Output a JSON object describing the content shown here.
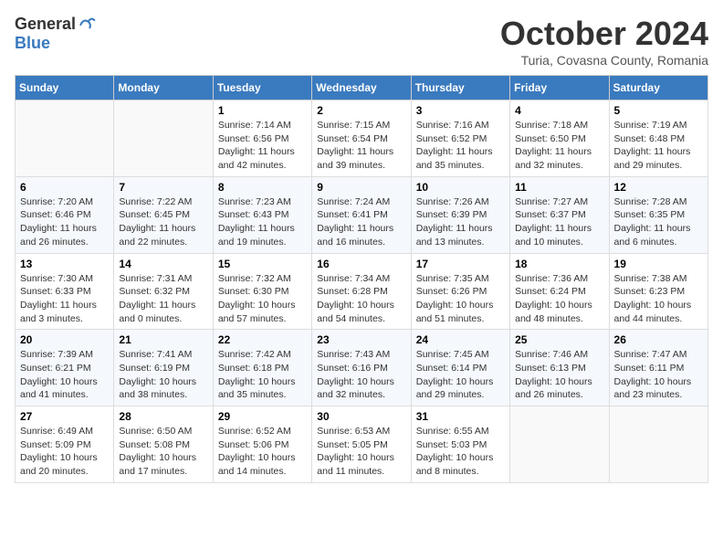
{
  "header": {
    "logo_general": "General",
    "logo_blue": "Blue",
    "month_title": "October 2024",
    "location": "Turia, Covasna County, Romania"
  },
  "weekdays": [
    "Sunday",
    "Monday",
    "Tuesday",
    "Wednesday",
    "Thursday",
    "Friday",
    "Saturday"
  ],
  "weeks": [
    [
      {
        "day": "",
        "sunrise": "",
        "sunset": "",
        "daylight": ""
      },
      {
        "day": "",
        "sunrise": "",
        "sunset": "",
        "daylight": ""
      },
      {
        "day": "1",
        "sunrise": "Sunrise: 7:14 AM",
        "sunset": "Sunset: 6:56 PM",
        "daylight": "Daylight: 11 hours and 42 minutes."
      },
      {
        "day": "2",
        "sunrise": "Sunrise: 7:15 AM",
        "sunset": "Sunset: 6:54 PM",
        "daylight": "Daylight: 11 hours and 39 minutes."
      },
      {
        "day": "3",
        "sunrise": "Sunrise: 7:16 AM",
        "sunset": "Sunset: 6:52 PM",
        "daylight": "Daylight: 11 hours and 35 minutes."
      },
      {
        "day": "4",
        "sunrise": "Sunrise: 7:18 AM",
        "sunset": "Sunset: 6:50 PM",
        "daylight": "Daylight: 11 hours and 32 minutes."
      },
      {
        "day": "5",
        "sunrise": "Sunrise: 7:19 AM",
        "sunset": "Sunset: 6:48 PM",
        "daylight": "Daylight: 11 hours and 29 minutes."
      }
    ],
    [
      {
        "day": "6",
        "sunrise": "Sunrise: 7:20 AM",
        "sunset": "Sunset: 6:46 PM",
        "daylight": "Daylight: 11 hours and 26 minutes."
      },
      {
        "day": "7",
        "sunrise": "Sunrise: 7:22 AM",
        "sunset": "Sunset: 6:45 PM",
        "daylight": "Daylight: 11 hours and 22 minutes."
      },
      {
        "day": "8",
        "sunrise": "Sunrise: 7:23 AM",
        "sunset": "Sunset: 6:43 PM",
        "daylight": "Daylight: 11 hours and 19 minutes."
      },
      {
        "day": "9",
        "sunrise": "Sunrise: 7:24 AM",
        "sunset": "Sunset: 6:41 PM",
        "daylight": "Daylight: 11 hours and 16 minutes."
      },
      {
        "day": "10",
        "sunrise": "Sunrise: 7:26 AM",
        "sunset": "Sunset: 6:39 PM",
        "daylight": "Daylight: 11 hours and 13 minutes."
      },
      {
        "day": "11",
        "sunrise": "Sunrise: 7:27 AM",
        "sunset": "Sunset: 6:37 PM",
        "daylight": "Daylight: 11 hours and 10 minutes."
      },
      {
        "day": "12",
        "sunrise": "Sunrise: 7:28 AM",
        "sunset": "Sunset: 6:35 PM",
        "daylight": "Daylight: 11 hours and 6 minutes."
      }
    ],
    [
      {
        "day": "13",
        "sunrise": "Sunrise: 7:30 AM",
        "sunset": "Sunset: 6:33 PM",
        "daylight": "Daylight: 11 hours and 3 minutes."
      },
      {
        "day": "14",
        "sunrise": "Sunrise: 7:31 AM",
        "sunset": "Sunset: 6:32 PM",
        "daylight": "Daylight: 11 hours and 0 minutes."
      },
      {
        "day": "15",
        "sunrise": "Sunrise: 7:32 AM",
        "sunset": "Sunset: 6:30 PM",
        "daylight": "Daylight: 10 hours and 57 minutes."
      },
      {
        "day": "16",
        "sunrise": "Sunrise: 7:34 AM",
        "sunset": "Sunset: 6:28 PM",
        "daylight": "Daylight: 10 hours and 54 minutes."
      },
      {
        "day": "17",
        "sunrise": "Sunrise: 7:35 AM",
        "sunset": "Sunset: 6:26 PM",
        "daylight": "Daylight: 10 hours and 51 minutes."
      },
      {
        "day": "18",
        "sunrise": "Sunrise: 7:36 AM",
        "sunset": "Sunset: 6:24 PM",
        "daylight": "Daylight: 10 hours and 48 minutes."
      },
      {
        "day": "19",
        "sunrise": "Sunrise: 7:38 AM",
        "sunset": "Sunset: 6:23 PM",
        "daylight": "Daylight: 10 hours and 44 minutes."
      }
    ],
    [
      {
        "day": "20",
        "sunrise": "Sunrise: 7:39 AM",
        "sunset": "Sunset: 6:21 PM",
        "daylight": "Daylight: 10 hours and 41 minutes."
      },
      {
        "day": "21",
        "sunrise": "Sunrise: 7:41 AM",
        "sunset": "Sunset: 6:19 PM",
        "daylight": "Daylight: 10 hours and 38 minutes."
      },
      {
        "day": "22",
        "sunrise": "Sunrise: 7:42 AM",
        "sunset": "Sunset: 6:18 PM",
        "daylight": "Daylight: 10 hours and 35 minutes."
      },
      {
        "day": "23",
        "sunrise": "Sunrise: 7:43 AM",
        "sunset": "Sunset: 6:16 PM",
        "daylight": "Daylight: 10 hours and 32 minutes."
      },
      {
        "day": "24",
        "sunrise": "Sunrise: 7:45 AM",
        "sunset": "Sunset: 6:14 PM",
        "daylight": "Daylight: 10 hours and 29 minutes."
      },
      {
        "day": "25",
        "sunrise": "Sunrise: 7:46 AM",
        "sunset": "Sunset: 6:13 PM",
        "daylight": "Daylight: 10 hours and 26 minutes."
      },
      {
        "day": "26",
        "sunrise": "Sunrise: 7:47 AM",
        "sunset": "Sunset: 6:11 PM",
        "daylight": "Daylight: 10 hours and 23 minutes."
      }
    ],
    [
      {
        "day": "27",
        "sunrise": "Sunrise: 6:49 AM",
        "sunset": "Sunset: 5:09 PM",
        "daylight": "Daylight: 10 hours and 20 minutes."
      },
      {
        "day": "28",
        "sunrise": "Sunrise: 6:50 AM",
        "sunset": "Sunset: 5:08 PM",
        "daylight": "Daylight: 10 hours and 17 minutes."
      },
      {
        "day": "29",
        "sunrise": "Sunrise: 6:52 AM",
        "sunset": "Sunset: 5:06 PM",
        "daylight": "Daylight: 10 hours and 14 minutes."
      },
      {
        "day": "30",
        "sunrise": "Sunrise: 6:53 AM",
        "sunset": "Sunset: 5:05 PM",
        "daylight": "Daylight: 10 hours and 11 minutes."
      },
      {
        "day": "31",
        "sunrise": "Sunrise: 6:55 AM",
        "sunset": "Sunset: 5:03 PM",
        "daylight": "Daylight: 10 hours and 8 minutes."
      },
      {
        "day": "",
        "sunrise": "",
        "sunset": "",
        "daylight": ""
      },
      {
        "day": "",
        "sunrise": "",
        "sunset": "",
        "daylight": ""
      }
    ]
  ]
}
